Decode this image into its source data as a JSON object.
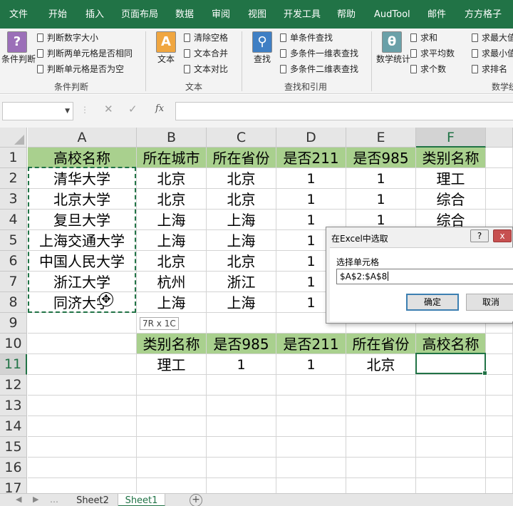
{
  "ribbon_tabs": [
    "文件",
    "开始",
    "插入",
    "页面布局",
    "数据",
    "审阅",
    "视图",
    "开发工具",
    "帮助",
    "AudTool",
    "邮件",
    "方方格子"
  ],
  "ribbon": {
    "condition_group": {
      "big_label": "条件判断",
      "items": [
        "判断数字大小",
        "判断两单元格是否相同",
        "判断单元格是否为空"
      ],
      "group_label": "条件判断"
    },
    "text_group": {
      "big_label": "文本",
      "items": [
        "清除空格",
        "文本合并",
        "文本对比"
      ],
      "group_label": "文本"
    },
    "lookup_group": {
      "big_label": "查找",
      "items": [
        "单条件查找",
        "多条件一维表查找",
        "多条件二维表查找"
      ],
      "group_label": "查找和引用"
    },
    "stats_group": {
      "big_label": "数学统计",
      "items": [
        "求和",
        "求平均数",
        "求个数"
      ],
      "items2": [
        "求最大值",
        "求最小值",
        "求排名"
      ],
      "group_label": "数学统计"
    }
  },
  "formula_bar": {
    "namebox": "",
    "cancel_icon": "✕",
    "enter_icon": "✓",
    "fx_label": "fx",
    "formula": ""
  },
  "sheet": {
    "columns": [
      "A",
      "B",
      "C",
      "D",
      "E",
      "F"
    ],
    "rows": [
      "1",
      "2",
      "3",
      "4",
      "5",
      "6",
      "7",
      "8",
      "9",
      "10",
      "11",
      "12",
      "13",
      "14",
      "15",
      "16",
      "17"
    ],
    "table_header": [
      "高校名称",
      "所在城市",
      "所在省份",
      "是否211",
      "是否985",
      "类别名称"
    ],
    "table_rows": [
      [
        "清华大学",
        "北京",
        "北京",
        "1",
        "1",
        "理工"
      ],
      [
        "北京大学",
        "北京",
        "北京",
        "1",
        "1",
        "综合"
      ],
      [
        "复旦大学",
        "上海",
        "上海",
        "1",
        "1",
        "综合"
      ],
      [
        "上海交通大学",
        "上海",
        "上海",
        "1",
        "",
        ""
      ],
      [
        "中国人民大学",
        "北京",
        "北京",
        "1",
        "",
        ""
      ],
      [
        "浙江大学",
        "杭州",
        "浙江",
        "1",
        "",
        ""
      ],
      [
        "同济大学",
        "上海",
        "上海",
        "1",
        "",
        ""
      ]
    ],
    "query_header": [
      "类别名称",
      "是否985",
      "是否211",
      "所在省份",
      "高校名称"
    ],
    "query_values": [
      "理工",
      "1",
      "1",
      "北京",
      ""
    ],
    "selection_tip": "7R x 1C"
  },
  "dialog": {
    "title": "在Excel中选取",
    "help": "?",
    "close": "x",
    "label": "选择单元格",
    "value": "$A$2:$A$8",
    "ok": "确定",
    "cancel": "取消"
  },
  "sheet_tabs": [
    "Sheet2",
    "Sheet1"
  ],
  "add_sheet": "+",
  "colors": {
    "accent": "#217346",
    "header_fill": "#a9d08e"
  }
}
